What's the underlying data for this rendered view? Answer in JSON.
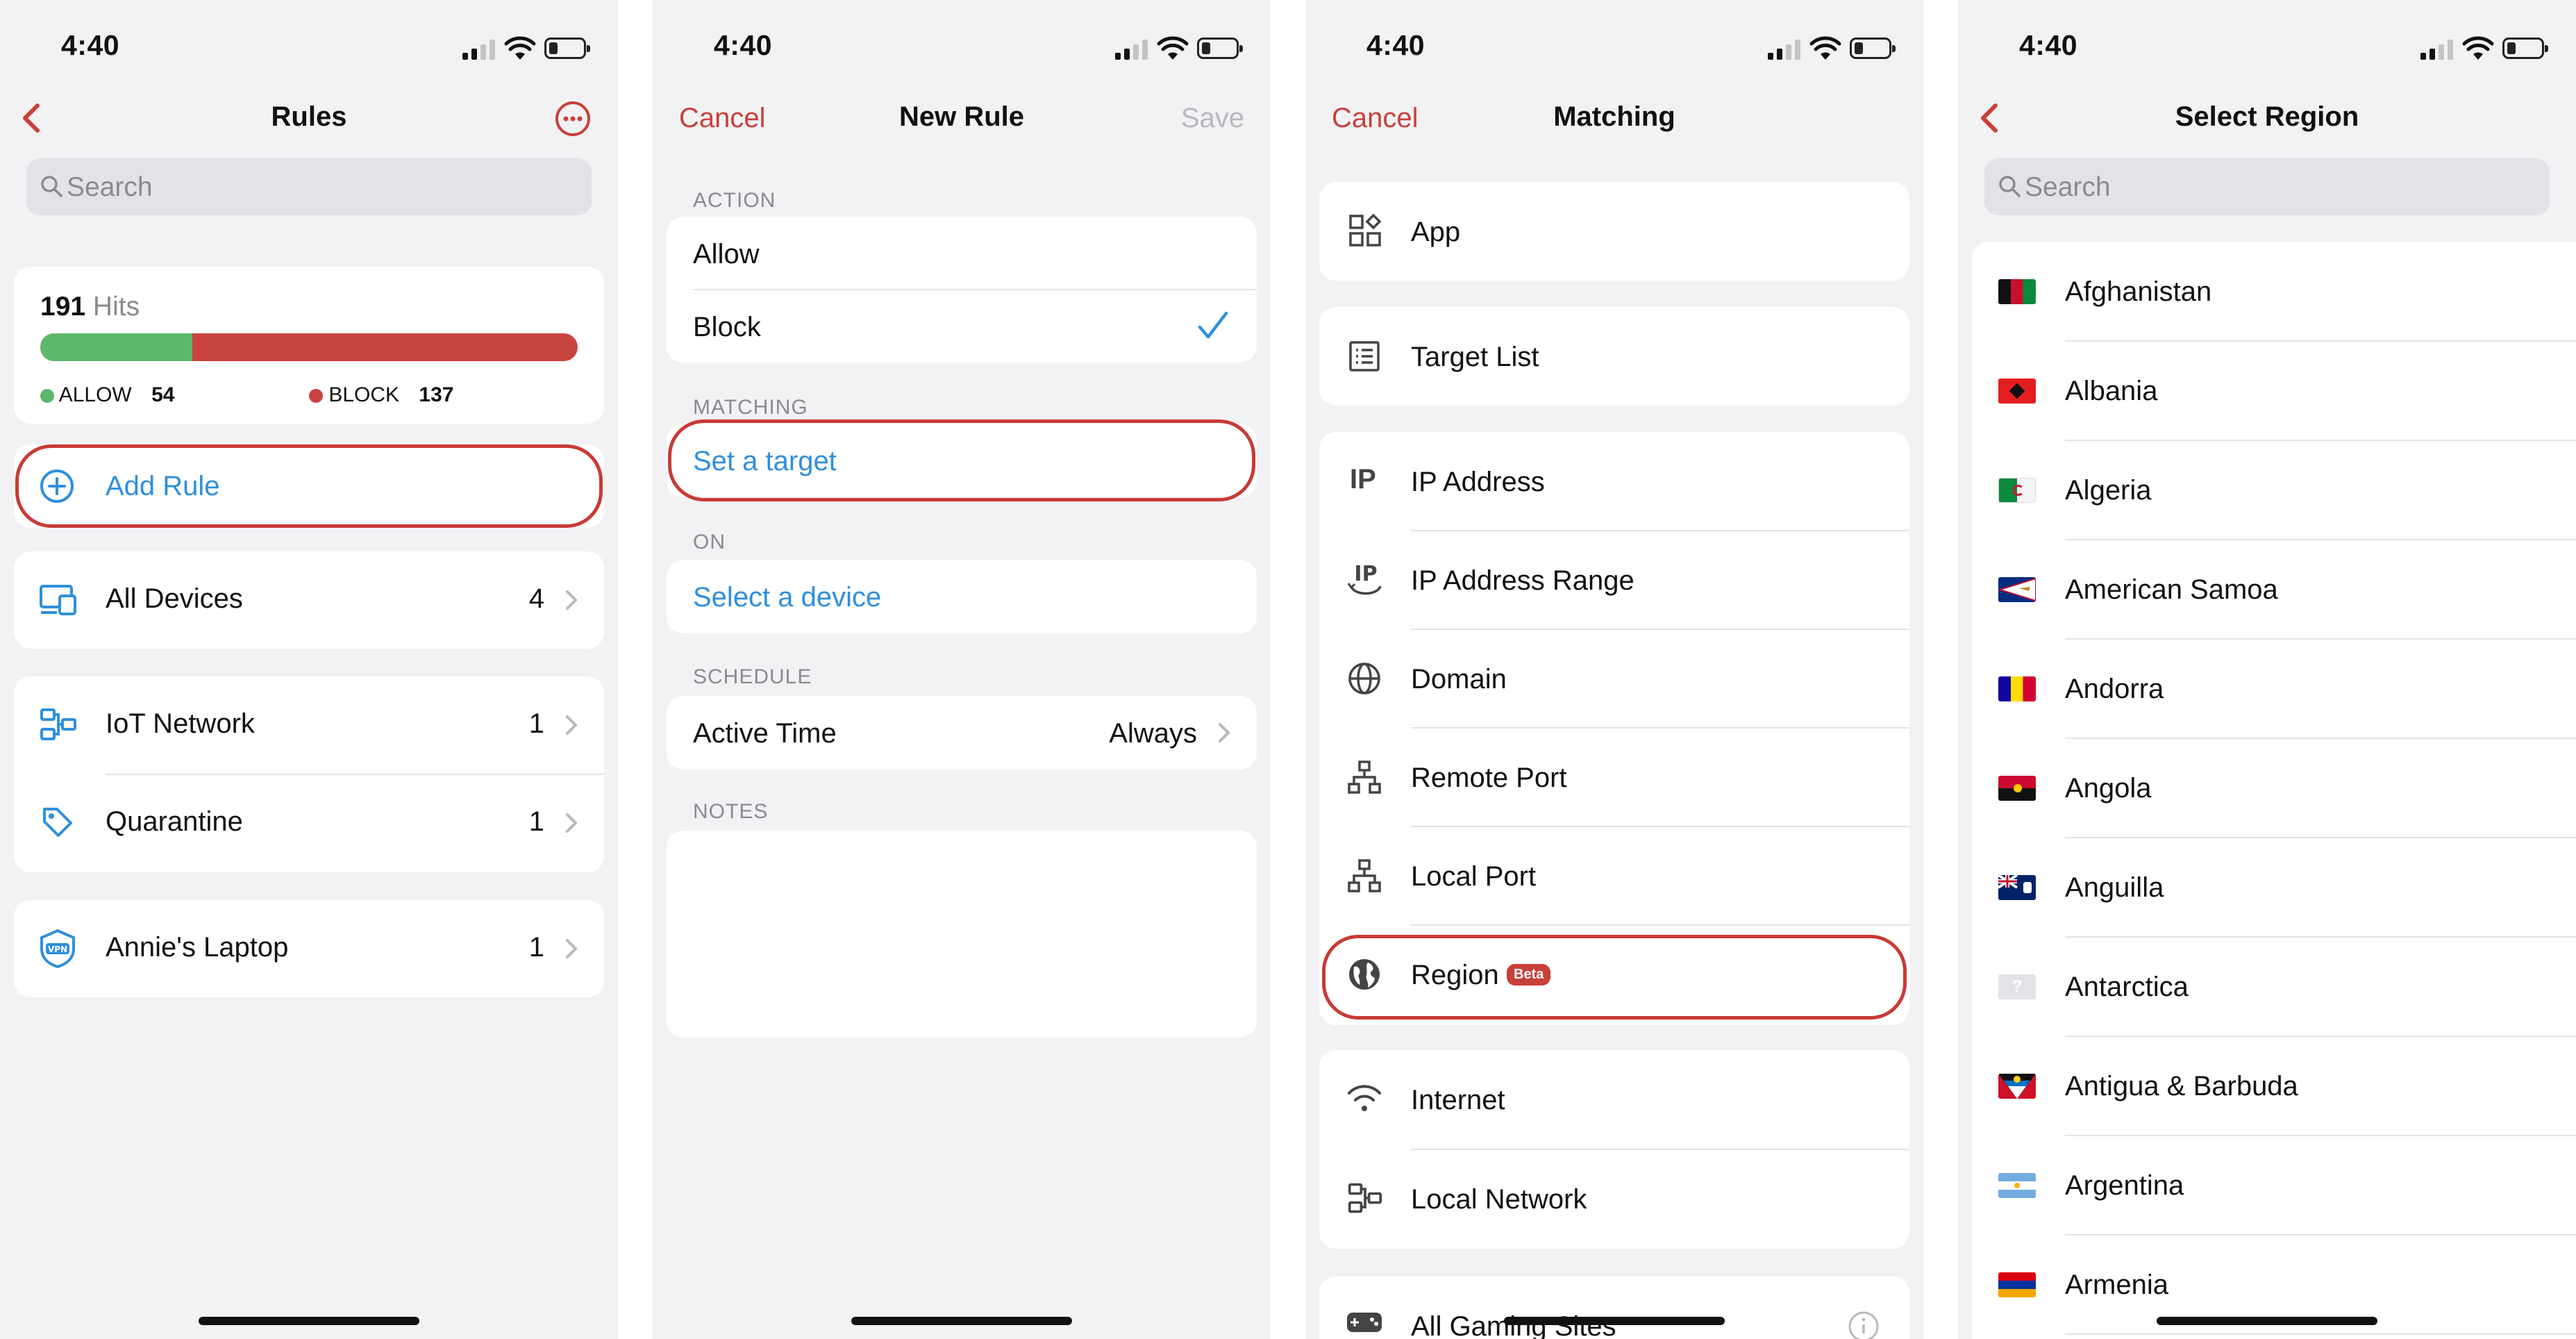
{
  "status": {
    "time": "4:40"
  },
  "rules_screen": {
    "title": "Rules",
    "search_placeholder": "Search",
    "hits_count": "191",
    "hits_label": "Hits",
    "allow_label": "ALLOW",
    "allow_count": "54",
    "block_label": "BLOCK",
    "block_count": "137",
    "allow_fraction": 0.283,
    "add_rule": "Add Rule",
    "all_devices": {
      "label": "All Devices",
      "count": "4"
    },
    "groups": [
      {
        "label": "IoT Network",
        "count": "1"
      },
      {
        "label": "Quarantine",
        "count": "1"
      }
    ],
    "laptop": {
      "label": "Annie's Laptop",
      "count": "1"
    },
    "colors": {
      "allow": "#5cb86c",
      "block": "#c8443e",
      "accent": "#c8403a"
    }
  },
  "new_rule_screen": {
    "cancel": "Cancel",
    "title": "New Rule",
    "save": "Save",
    "action_header": "ACTION",
    "allow": "Allow",
    "block": "Block",
    "matching_header": "MATCHING",
    "set_target": "Set a target",
    "on_header": "ON",
    "select_device": "Select a device",
    "schedule_header": "SCHEDULE",
    "active_time": "Active Time",
    "active_time_value": "Always",
    "notes_header": "NOTES"
  },
  "matching_screen": {
    "cancel": "Cancel",
    "title": "Matching",
    "app": "App",
    "target_list": "Target List",
    "ip_group": [
      "IP Address",
      "IP Address Range",
      "Domain",
      "Remote Port",
      "Local Port",
      "Region"
    ],
    "region_badge": "Beta",
    "network_group": [
      "Internet",
      "Local Network"
    ],
    "gaming": "All Gaming Sites"
  },
  "region_screen": {
    "title": "Select Region",
    "search_placeholder": "Search",
    "countries": [
      "Afghanistan",
      "Albania",
      "Algeria",
      "American Samoa",
      "Andorra",
      "Angola",
      "Anguilla",
      "Antarctica",
      "Antigua & Barbuda",
      "Argentina",
      "Armenia"
    ]
  }
}
